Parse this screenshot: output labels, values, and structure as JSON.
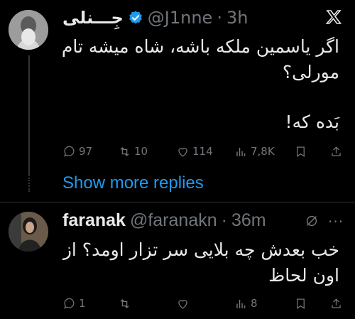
{
  "tweet1": {
    "display_name": "جِـــنلی",
    "handle": "@J1nne",
    "time": "3h",
    "text_line1": "اگر یاسمین ملکه باشه، شاه میشه تام",
    "text_line2": "مورلی؟",
    "text_line3": "بَده که!",
    "replies": "97",
    "retweets": "10",
    "likes": "114",
    "views": "7,8K"
  },
  "show_more": "Show more replies",
  "tweet2": {
    "display_name": "faranak",
    "handle": "@faranakn",
    "time": "36m",
    "text_line1": "خب بعدش چه بلایی سر تزار اومد؟ از",
    "text_line2": "اون لحاظ",
    "replies": "1",
    "retweets": "",
    "likes": "",
    "views": "8"
  },
  "colors": {
    "accent": "#1d9bf0",
    "muted": "#71767b",
    "text": "#e7e9ea"
  }
}
